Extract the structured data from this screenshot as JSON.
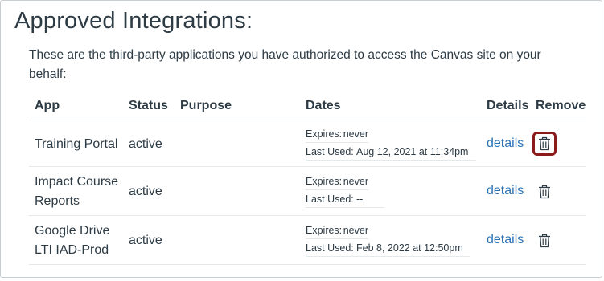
{
  "title": "Approved Integrations:",
  "description": "These are the third-party applications you have authorized to access the Canvas site on your behalf:",
  "columns": {
    "app": "App",
    "status": "Status",
    "purpose": "Purpose",
    "dates": "Dates",
    "details": "Details",
    "remove": "Remove"
  },
  "dates_labels": {
    "expires": "Expires:",
    "last_used": "Last Used:"
  },
  "rows": [
    {
      "app": "Training Portal",
      "status": "active",
      "purpose": "",
      "expires": "never",
      "last_used": "Aug 12, 2021 at 11:34pm",
      "details": "details",
      "remove_icon": "trash-icon"
    },
    {
      "app": "Impact Course Reports",
      "status": "active",
      "purpose": "",
      "expires": "never",
      "last_used": "--",
      "details": "details",
      "remove_icon": "trash-icon"
    },
    {
      "app": "Google Drive LTI IAD-Prod",
      "status": "active",
      "purpose": "",
      "expires": "never",
      "last_used": "Feb 8, 2022 at 12:50pm",
      "details": "details",
      "remove_icon": "trash-icon"
    }
  ],
  "colors": {
    "link": "#2a73b6",
    "focus_ring": "#8b1a1a",
    "text": "#2d3b45"
  }
}
